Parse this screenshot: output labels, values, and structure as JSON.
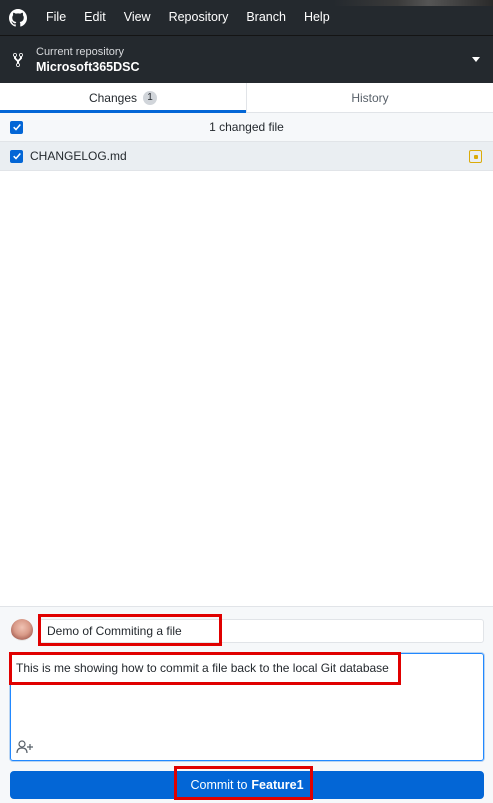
{
  "menubar": {
    "logo_icon": "github-mark-icon",
    "items": [
      {
        "label": "File"
      },
      {
        "label": "Edit"
      },
      {
        "label": "View"
      },
      {
        "label": "Repository"
      },
      {
        "label": "Branch"
      },
      {
        "label": "Help"
      }
    ]
  },
  "repository": {
    "caption": "Current repository",
    "name": "Microsoft365DSC",
    "icon": "repo-fork-icon",
    "dropdown_icon": "caret-down-icon"
  },
  "tabs": [
    {
      "label": "Changes",
      "badge": "1",
      "active": true
    },
    {
      "label": "History",
      "active": false
    }
  ],
  "changes": {
    "select_all_checked": true,
    "count_label": "1 changed file",
    "files": [
      {
        "name": "CHANGELOG.md",
        "checked": true,
        "status_icon": "file-modified-icon"
      }
    ]
  },
  "commit": {
    "summary_value": "Demo of Commiting a file",
    "description_value": "This is me showing how to commit a file back to the local Git database",
    "coauthor_icon": "add-coauthor-icon",
    "button_prefix": "Commit to",
    "branch": "Feature1"
  },
  "colors": {
    "chrome_dark": "#24292e",
    "accent_blue": "#0366d6",
    "modified_yellow": "#dbab09",
    "callout_red": "#e00000"
  }
}
